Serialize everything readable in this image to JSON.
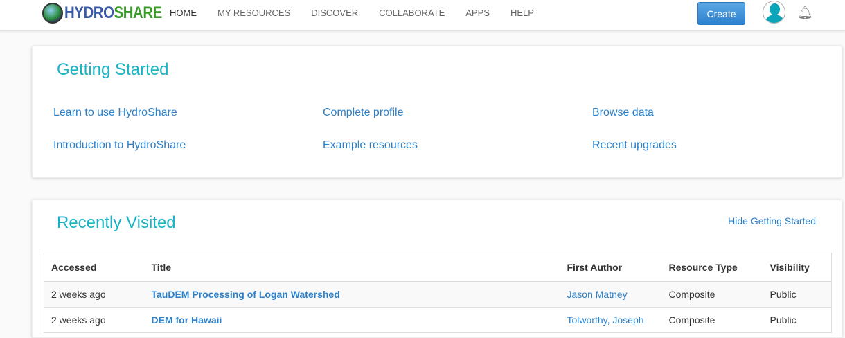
{
  "nav": {
    "logo_part1": "HYDRO",
    "logo_part2": "SHARE",
    "items": [
      "HOME",
      "MY RESOURCES",
      "DISCOVER",
      "COLLABORATE",
      "APPS",
      "HELP"
    ],
    "create_label": "Create"
  },
  "getting_started": {
    "title": "Getting Started",
    "links": [
      "Learn to use HydroShare",
      "Complete profile",
      "Browse data",
      "Introduction to HydroShare",
      "Example resources",
      "Recent upgrades"
    ]
  },
  "recent": {
    "title": "Recently Visited",
    "hide_label": "Hide Getting Started",
    "headers": [
      "Accessed",
      "Title",
      "First Author",
      "Resource Type",
      "Visibility"
    ],
    "rows": [
      {
        "accessed": "2 weeks ago",
        "title": "TauDEM Processing of Logan Watershed",
        "author": "Jason Matney",
        "type": "Composite",
        "visibility": "Public"
      },
      {
        "accessed": "2 weeks ago",
        "title": "DEM for Hawaii",
        "author": "Tolworthy, Joseph",
        "type": "Composite",
        "visibility": "Public"
      }
    ]
  }
}
